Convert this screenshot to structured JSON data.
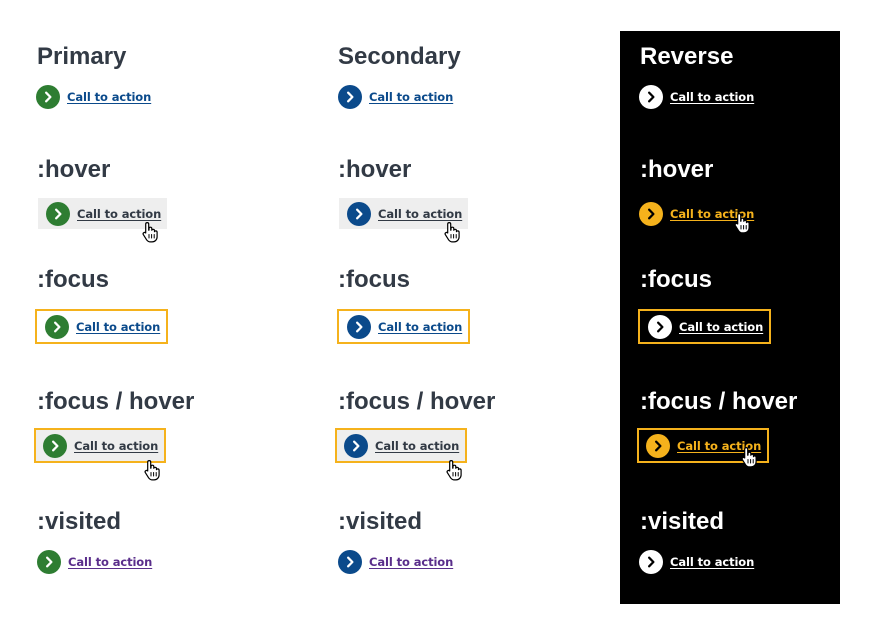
{
  "colors": {
    "heading": "#323a45",
    "primary_circle": "#2e7d32",
    "secondary_circle": "#0b4a8b",
    "reverse_circle": "#ffffff",
    "reverse_hover_circle": "#f5b21c",
    "link": "#0b4a8b",
    "link_hover": "#323a45",
    "link_visited": "#5a2e8b",
    "focus_outline": "#f5b21c",
    "hover_bg": "#eeeeee",
    "reverse_bg": "#000000"
  },
  "columns": [
    {
      "key": "primary",
      "title": "Primary",
      "states": [
        {
          "heading": "",
          "label": "Call to action"
        },
        {
          "heading": ":hover",
          "label": "Call to action"
        },
        {
          "heading": ":focus",
          "label": "Call to action"
        },
        {
          "heading": ":focus / hover",
          "label": "Call to action"
        },
        {
          "heading": ":visited",
          "label": "Call to action"
        }
      ]
    },
    {
      "key": "secondary",
      "title": "Secondary",
      "states": [
        {
          "heading": "",
          "label": "Call to action"
        },
        {
          "heading": ":hover",
          "label": "Call to action"
        },
        {
          "heading": ":focus",
          "label": "Call to action"
        },
        {
          "heading": ":focus / hover",
          "label": "Call to action"
        },
        {
          "heading": ":visited",
          "label": "Call to action"
        }
      ]
    },
    {
      "key": "reverse",
      "title": "Reverse",
      "states": [
        {
          "heading": "",
          "label": "Call to action"
        },
        {
          "heading": ":hover",
          "label": "Call to action"
        },
        {
          "heading": ":focus",
          "label": "Call to action"
        },
        {
          "heading": ":focus / hover",
          "label": "Call to action"
        },
        {
          "heading": ":visited",
          "label": "Call to action"
        }
      ]
    }
  ]
}
